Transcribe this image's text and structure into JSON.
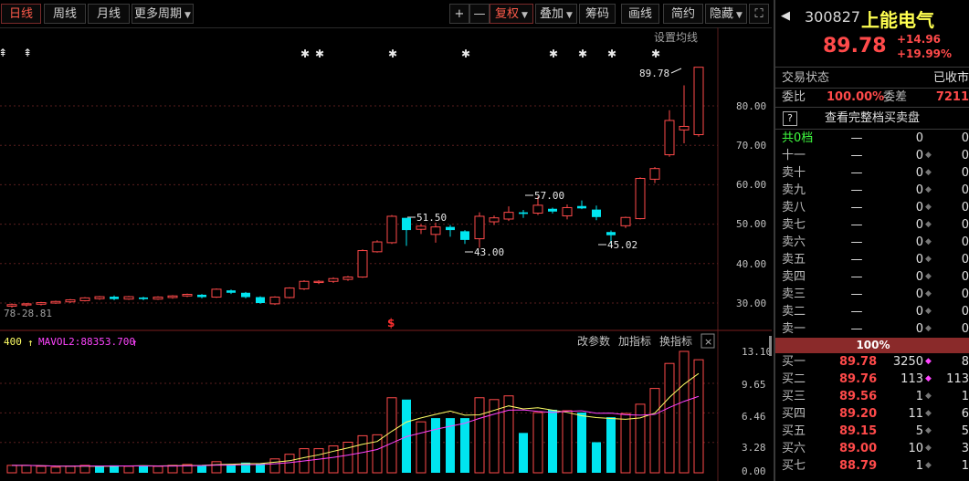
{
  "toolbar": {
    "period_tabs": [
      "日线",
      "周线",
      "月线",
      "更多周期"
    ],
    "plus": "+",
    "minus": "—",
    "fuquan": "复权",
    "overlay": "叠加",
    "chips": "筹码",
    "draw": "画线",
    "simple": "简约",
    "hide": "隐藏",
    "fullscreen_icon": "fullscreen-icon"
  },
  "kline": {
    "ma_settings": "设置均线",
    "annotations": {
      "high": "89.78",
      "a1": "51.50",
      "a2": "43.00",
      "a3": "57.00",
      "a4": "45.02",
      "left": "78-28.81",
      "dollar": "$"
    },
    "y_ticks": [
      "80.00",
      "70.00",
      "60.00",
      "50.00",
      "40.00",
      "30.00"
    ]
  },
  "volume": {
    "left_label": "400",
    "mavol2": "MAVOL2:88353.700",
    "buttons": [
      "改参数",
      "加指标",
      "换指标"
    ],
    "y_ticks": [
      "13.10",
      "9.65",
      "6.46",
      "3.28",
      "0.00"
    ]
  },
  "chart_data": {
    "type": "candlestick",
    "y_range": [
      27,
      92
    ],
    "volume_range": [
      0,
      13.1
    ],
    "candles": [
      [
        29.2,
        29.6,
        28.8,
        29.9
      ],
      [
        29.5,
        29.8,
        29.1,
        30.0
      ],
      [
        29.7,
        30.1,
        29.4,
        30.3
      ],
      [
        30.0,
        30.4,
        29.8,
        30.6
      ],
      [
        30.3,
        30.8,
        30.0,
        31.0
      ],
      [
        30.6,
        31.3,
        30.4,
        31.5
      ],
      [
        31.1,
        31.6,
        30.8,
        31.8
      ],
      [
        31.6,
        31.0,
        30.7,
        31.9
      ],
      [
        31.0,
        31.6,
        30.8,
        31.8
      ],
      [
        31.4,
        31.0,
        30.7,
        31.6
      ],
      [
        31.0,
        31.5,
        30.8,
        31.7
      ],
      [
        31.4,
        31.8,
        31.1,
        32.0
      ],
      [
        31.8,
        32.2,
        31.5,
        32.4
      ],
      [
        32.1,
        31.5,
        31.2,
        32.3
      ],
      [
        31.5,
        33.5,
        31.3,
        33.7
      ],
      [
        33.2,
        32.6,
        32.3,
        33.4
      ],
      [
        32.6,
        31.5,
        31.2,
        32.8
      ],
      [
        31.5,
        30.0,
        29.8,
        31.7
      ],
      [
        29.8,
        31.5,
        29.5,
        31.7
      ],
      [
        31.4,
        33.8,
        31.2,
        34.0
      ],
      [
        33.6,
        35.5,
        33.3,
        35.8
      ],
      [
        35.2,
        35.5,
        34.8,
        35.8
      ],
      [
        35.5,
        36.2,
        35.1,
        36.5
      ],
      [
        36.0,
        36.6,
        35.6,
        36.9
      ],
      [
        36.6,
        43.3,
        36.4,
        43.6
      ],
      [
        43.0,
        45.5,
        42.8,
        45.9
      ],
      [
        45.3,
        52.0,
        45.0,
        52.3
      ],
      [
        51.6,
        48.5,
        44.5,
        51.6
      ],
      [
        48.7,
        49.5,
        47.5,
        50.0
      ],
      [
        47.4,
        49.3,
        45.3,
        50.4
      ],
      [
        49.3,
        48.5,
        46.8,
        49.8
      ],
      [
        48.2,
        46.0,
        45.0,
        48.5
      ],
      [
        46.3,
        52.0,
        44.0,
        53.0
      ],
      [
        50.6,
        51.6,
        49.8,
        52.2
      ],
      [
        51.3,
        53.0,
        50.8,
        54.5
      ],
      [
        53.0,
        52.6,
        51.6,
        53.6
      ],
      [
        52.8,
        54.8,
        52.3,
        57.0
      ],
      [
        53.9,
        53.2,
        52.7,
        54.2
      ],
      [
        52.1,
        54.2,
        51.2,
        55.0
      ],
      [
        54.6,
        54.0,
        53.8,
        56.0
      ],
      [
        53.7,
        51.8,
        51.0,
        54.7
      ],
      [
        48.0,
        47.2,
        45.0,
        48.4
      ],
      [
        49.6,
        51.7,
        49.0,
        51.9
      ],
      [
        51.4,
        61.6,
        51.2,
        61.9
      ],
      [
        61.4,
        64.1,
        60.4,
        64.5
      ],
      [
        67.6,
        76.3,
        67.1,
        78.9
      ],
      [
        73.9,
        74.8,
        70.5,
        85.2
      ],
      [
        72.7,
        89.8,
        72.2,
        89.8
      ]
    ],
    "volume": [
      0.8,
      0.8,
      0.7,
      0.6,
      0.7,
      0.8,
      0.7,
      0.8,
      0.7,
      0.8,
      0.7,
      0.8,
      0.9,
      0.8,
      1.2,
      0.9,
      1.1,
      1.0,
      1.5,
      2.0,
      2.6,
      2.6,
      2.9,
      3.3,
      4.0,
      4.1,
      8.1,
      7.9,
      5.5,
      5.9,
      5.9,
      5.9,
      8.1,
      7.9,
      8.3,
      4.3,
      6.5,
      6.8,
      6.7,
      6.5,
      3.3,
      6.0,
      6.4,
      7.4,
      9.1,
      11.8,
      13.1,
      12.2
    ],
    "volume_up": [
      true,
      true,
      true,
      true,
      true,
      true,
      false,
      false,
      true,
      false,
      true,
      true,
      true,
      false,
      true,
      false,
      false,
      false,
      true,
      true,
      true,
      true,
      true,
      true,
      true,
      true,
      true,
      false,
      true,
      false,
      false,
      false,
      true,
      true,
      true,
      false,
      true,
      false,
      true,
      false,
      false,
      false,
      true,
      true,
      true,
      true,
      true,
      true
    ]
  },
  "panel": {
    "code": "300827",
    "name": "上能电气",
    "price": "89.78",
    "change": "+14.96",
    "pct": "+19.99%",
    "trade_state_label": "交易状态",
    "trade_state_value": "已收市",
    "weibi_label": "委比",
    "weibi_value": "100.00%",
    "weicha_label": "委差",
    "weicha_value": "7211",
    "full_book": "查看完整档买卖盘",
    "help_icon": "?",
    "sell_header": "共0档",
    "sell_levels": [
      "十一",
      "卖十",
      "卖九",
      "卖八",
      "卖七",
      "卖六",
      "卖五",
      "卖四",
      "卖三",
      "卖二",
      "卖一"
    ],
    "dash": "—",
    "zero": "0",
    "ratio_bar": "100%",
    "buy_levels": [
      {
        "name": "买一",
        "price": "89.78",
        "vol": "3250",
        "extra": "8"
      },
      {
        "name": "买二",
        "price": "89.76",
        "vol": "113",
        "extra": "113"
      },
      {
        "name": "买三",
        "price": "89.56",
        "vol": "1",
        "extra": "1"
      },
      {
        "name": "买四",
        "price": "89.20",
        "vol": "11",
        "extra": "6"
      },
      {
        "name": "买五",
        "price": "89.15",
        "vol": "5",
        "extra": "5"
      },
      {
        "name": "买六",
        "price": "89.00",
        "vol": "10",
        "extra": "3"
      },
      {
        "name": "买七",
        "price": "88.79",
        "vol": "1",
        "extra": "1"
      }
    ],
    "colors": {
      "up": "#ff4a4a",
      "down": "#00e5f0",
      "ma1": "#ffff66",
      "ma2": "#ff44ff"
    }
  }
}
